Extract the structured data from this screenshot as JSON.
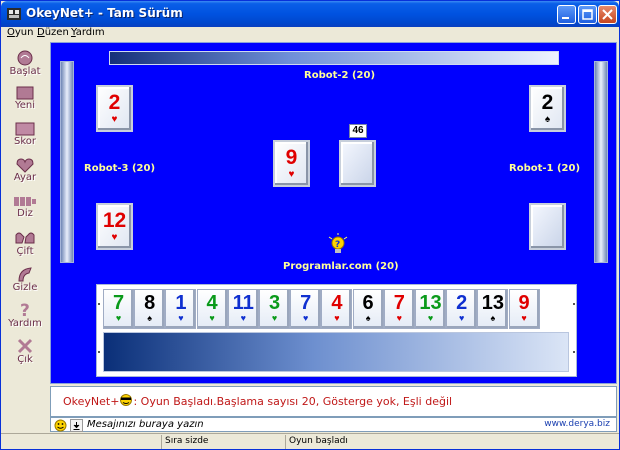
{
  "window": {
    "title": "OkeyNet+ - Tam Sürüm"
  },
  "menu": [
    {
      "label": "Oyun",
      "underline": "O",
      "rest": "yun"
    },
    {
      "label": "Düzen",
      "underline": "D",
      "rest": "üzen"
    },
    {
      "label": "Yardım",
      "underline": "Y",
      "rest": "ardım"
    }
  ],
  "toolbar": [
    {
      "label": "Başlat",
      "icon": "start-icon"
    },
    {
      "label": "Yeni",
      "icon": "new-icon"
    },
    {
      "label": "Skor",
      "icon": "score-icon"
    },
    {
      "label": "Ayar",
      "icon": "settings-icon"
    },
    {
      "label": "Diz",
      "icon": "arrange-icon"
    },
    {
      "label": "Çift",
      "icon": "pairs-icon"
    },
    {
      "label": "Gizle",
      "icon": "hide-icon"
    },
    {
      "label": "Yardım",
      "icon": "help-icon"
    },
    {
      "label": "Çık",
      "icon": "exit-icon"
    }
  ],
  "players": {
    "robot2": "Robot-2 (20)",
    "robot3": "Robot-3 (20)",
    "robot1": "Robot-1 (20)",
    "me": "Programlar.com (20)"
  },
  "table": {
    "deck_count": "46",
    "center_tile": {
      "num": "9",
      "color": "#e00000",
      "sym": "♥"
    },
    "robot3_top": {
      "num": "2",
      "color": "#e00000",
      "sym": "♥"
    },
    "robot3_bottom": {
      "num": "12",
      "color": "#e00000",
      "sym": "♥"
    },
    "robot1_top": {
      "num": "2",
      "color": "#000000",
      "sym": "♠"
    }
  },
  "rack": [
    {
      "num": "7",
      "color": "#0a9a1a",
      "sym": "♥"
    },
    {
      "num": "8",
      "color": "#000000",
      "sym": "♠"
    },
    {
      "num": "1",
      "color": "#1030d0",
      "sym": "♥"
    },
    {
      "num": "4",
      "color": "#0a9a1a",
      "sym": "♥"
    },
    {
      "num": "11",
      "color": "#1030d0",
      "sym": "♥"
    },
    {
      "num": "3",
      "color": "#0a9a1a",
      "sym": "♥"
    },
    {
      "num": "7",
      "color": "#1030d0",
      "sym": "♥"
    },
    {
      "num": "4",
      "color": "#e00000",
      "sym": "♥"
    },
    {
      "num": "6",
      "color": "#000000",
      "sym": "♠"
    },
    {
      "num": "7",
      "color": "#e00000",
      "sym": "♥"
    },
    {
      "num": "13",
      "color": "#0a9a1a",
      "sym": "♥"
    },
    {
      "num": "2",
      "color": "#1030d0",
      "sym": "♥"
    },
    {
      "num": "13",
      "color": "#000000",
      "sym": "♠"
    },
    {
      "num": "9",
      "color": "#e00000",
      "sym": "♥"
    }
  ],
  "chat": {
    "name": "OkeyNet+",
    "message": ": Oyun Başladı.Başlama sayısı 20, Gösterge yok, Eşli değil",
    "input_placeholder": "Mesajınızı buraya yazın",
    "link": "www.derya.biz"
  },
  "status": {
    "pane1": "",
    "pane2": "Sıra sizde",
    "pane3": "Oyun başladı"
  }
}
